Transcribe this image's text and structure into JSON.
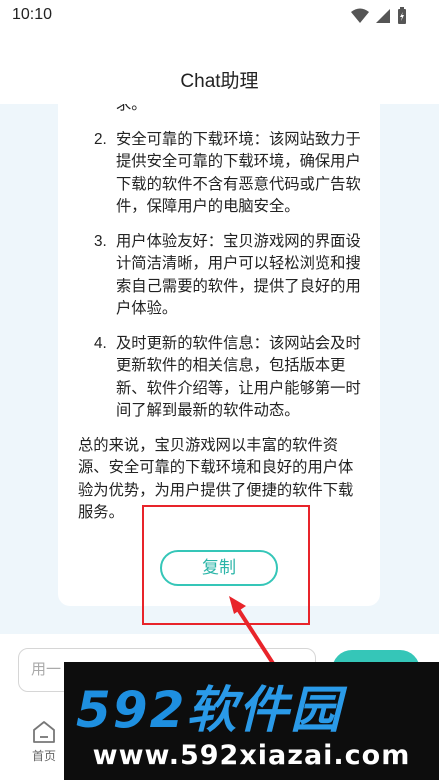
{
  "status_bar": {
    "time": "10:10"
  },
  "header": {
    "title": "Chat助理"
  },
  "answer": {
    "items": [
      {
        "num": "",
        "text": "求。"
      },
      {
        "num": "2.",
        "text": "安全可靠的下载环境：该网站致力于提供安全可靠的下载环境，确保用户下载的软件不含有恶意代码或广告软件，保障用户的电脑安全。"
      },
      {
        "num": "3.",
        "text": "用户体验友好：宝贝游戏网的界面设计简洁清晰，用户可以轻松浏览和搜索自己需要的软件，提供了良好的用户体验。"
      },
      {
        "num": "4.",
        "text": "及时更新的软件信息：该网站会及时更新软件的相关信息，包括版本更新、软件介绍等，让用户能够第一时间了解到最新的软件动态。"
      }
    ],
    "summary": "总的来说，宝贝游戏网以丰富的软件资源、安全可靠的下载环境和良好的用户体验为优势，为用户提供了便捷的软件下载服务。",
    "copy_label": "复制"
  },
  "input_bar": {
    "placeholder": "用一"
  },
  "nav": {
    "home_label": "首页"
  },
  "watermark": {
    "logo_num": "592",
    "logo_cn": "软件园",
    "url": "www.592xiazai.com"
  },
  "colors": {
    "accent": "#35c6b8",
    "highlight": "#e8242a",
    "chat_bg": "#eef6fb"
  }
}
